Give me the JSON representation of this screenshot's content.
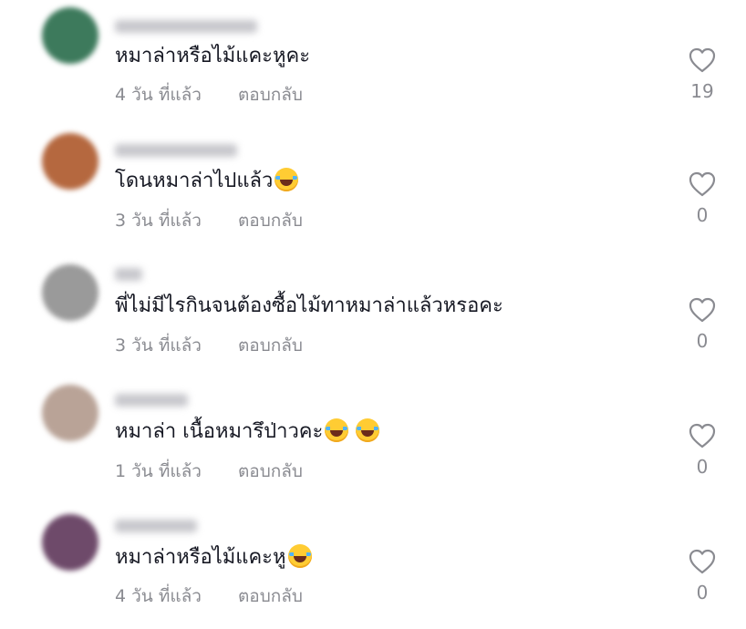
{
  "comments": [
    {
      "text": "หมาล่าหรือไม้แคะหูคะ",
      "emojis": [],
      "time": "4 วัน ที่แล้ว",
      "reply": "ตอบกลับ",
      "likes": "19",
      "avatar_color": "#3d7a5c"
    },
    {
      "text": "โดนหมาล่าไปแล้ว",
      "emojis": [
        "laughing-crying-emoji"
      ],
      "time": "3 วัน ที่แล้ว",
      "reply": "ตอบกลับ",
      "likes": "0",
      "avatar_color": "#b5683f"
    },
    {
      "text": "พี่ไม่มีไรกินจนต้องซื้อไม้ทาหมาล่าแล้วหรอคะ",
      "emojis": [],
      "time": "3 วัน ที่แล้ว",
      "reply": "ตอบกลับ",
      "likes": "0",
      "avatar_color": "#9a9a9a"
    },
    {
      "text": "หมาล่า เนื้อหมารึป่าวคะ",
      "emojis": [
        "laughing-crying-emoji",
        "laughing-crying-emoji"
      ],
      "time": "1 วัน ที่แล้ว",
      "reply": "ตอบกลับ",
      "likes": "0",
      "avatar_color": "#b9a397"
    },
    {
      "text": "หมาล่าหรือไม้แคะหู",
      "emojis": [
        "laughing-crying-emoji"
      ],
      "time": "4 วัน ที่แล้ว",
      "reply": "ตอบกลับ",
      "likes": "0",
      "avatar_color": "#6e4a6a"
    }
  ],
  "icons": {
    "like": "heart-outline-icon",
    "emoji": "laughing-crying-emoji"
  },
  "colors": {
    "text": "#161823",
    "meta": "#8a8b91",
    "heart": "#8a8b91"
  }
}
